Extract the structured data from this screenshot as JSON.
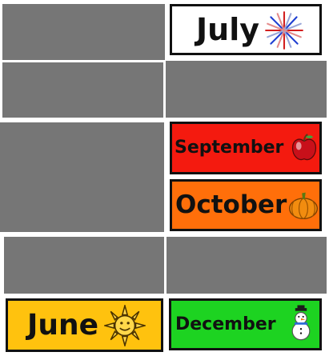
{
  "cards": {
    "july": {
      "label": "July",
      "color": "#ffffff",
      "icon": "fireworks-icon"
    },
    "september": {
      "label": "September",
      "color": "#f41a0f",
      "icon": "apple-icon"
    },
    "october": {
      "label": "October",
      "color": "#ff6f0a",
      "icon": "pumpkin-icon"
    },
    "june": {
      "label": "June",
      "color": "#ffc20e",
      "icon": "sun-icon"
    },
    "december": {
      "label": "December",
      "color": "#1dd321",
      "icon": "snowman-icon"
    }
  },
  "placeholder_color": "#767676"
}
